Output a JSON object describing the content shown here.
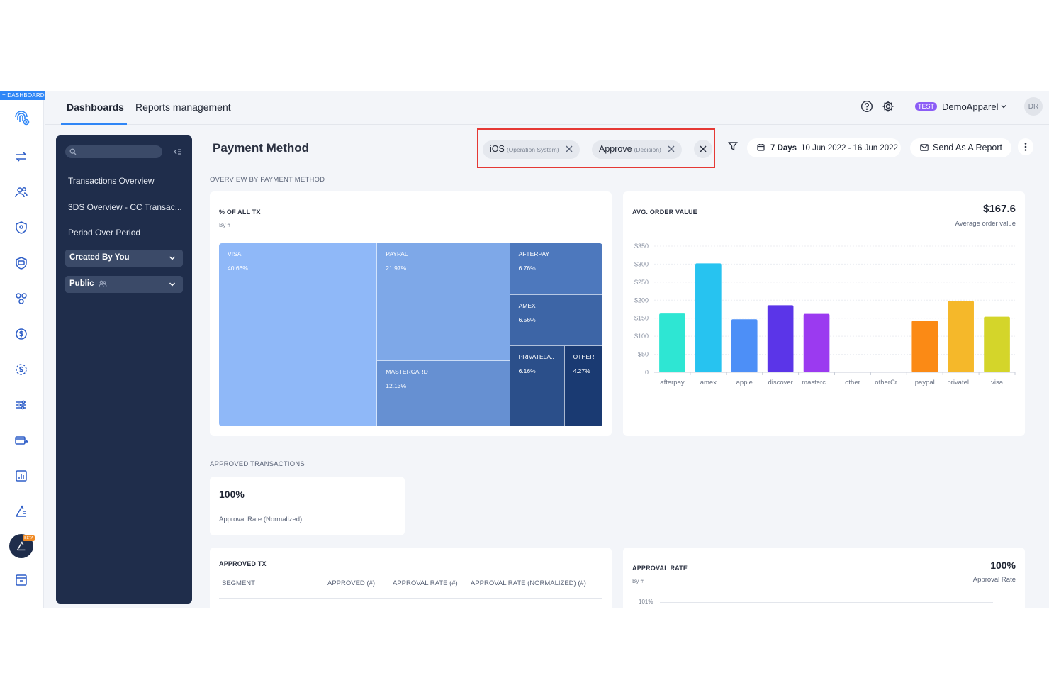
{
  "rail": {
    "tag": "= DASHBOARD",
    "beta": "BETA"
  },
  "topbar": {
    "tabs": [
      {
        "label": "Dashboards"
      },
      {
        "label": "Reports management"
      }
    ],
    "env_badge": "TEST",
    "account": "DemoApparel",
    "avatar": "DR"
  },
  "sidebar": {
    "search_placeholder": "",
    "links": [
      "Transactions Overview",
      "3DS Overview - CC Transac...",
      "Period Over Period"
    ],
    "created_by": "Created By You",
    "visibility": "Public"
  },
  "page": {
    "title": "Payment Method",
    "filters": [
      {
        "value": "iOS",
        "type": "(Operation System)"
      },
      {
        "value": "Approve",
        "type": "(Decision)"
      }
    ],
    "date": {
      "range_label": "7 Days",
      "range": "10 Jun 2022 - 16 Jun 2022"
    },
    "send_label": "Send As A Report"
  },
  "overview": {
    "section_label": "OVERVIEW BY PAYMENT METHOD",
    "treemap": {
      "title": "% OF ALL TX",
      "subtitle": "By #"
    },
    "aov": {
      "title": "AVG. ORDER VALUE",
      "value": "$167.6",
      "caption": "Average order value"
    }
  },
  "approved": {
    "section_label": "APPROVED TRANSACTIONS",
    "kpi_value": "100%",
    "kpi_caption": "Approval Rate (Normalized)",
    "tx_table": {
      "title": "APPROVED TX",
      "columns": [
        "SEGMENT",
        "APPROVED (#)",
        "APPROVAL RATE (#)",
        "APPROVAL RATE (NORMALIZED) (#)"
      ]
    },
    "approval_rate": {
      "title": "APPROVAL RATE",
      "subtitle": "By #",
      "value": "100%",
      "caption": "Approval Rate",
      "first_tick": "101%"
    }
  },
  "chart_data": [
    {
      "type": "treemap",
      "title": "% OF ALL TX",
      "subtitle": "By #",
      "items": [
        {
          "name": "VISA",
          "label": "40.66%",
          "value": 40.66,
          "color": "#8fb8f8"
        },
        {
          "name": "PAYPAL",
          "label": "21.97%",
          "value": 21.97,
          "color": "#7ea8e8"
        },
        {
          "name": "MASTERCARD",
          "label": "12.13%",
          "value": 12.13,
          "color": "#6690d2"
        },
        {
          "name": "AFTERPAY",
          "label": "6.76%",
          "value": 6.76,
          "color": "#4d78bd"
        },
        {
          "name": "AMEX",
          "label": "6.56%",
          "value": 6.56,
          "color": "#3d65a6"
        },
        {
          "name": "PRIVATELA..",
          "label": "6.16%",
          "value": 6.16,
          "color": "#2b4f8a"
        },
        {
          "name": "OTHER",
          "label": "4.27%",
          "value": 4.27,
          "color": "#1a3a72"
        }
      ]
    },
    {
      "type": "bar",
      "title": "AVG. ORDER VALUE",
      "categories": [
        "afterpay",
        "amex",
        "apple",
        "discover",
        "masterc...",
        "other",
        "otherCr...",
        "paypal",
        "privatel...",
        "visa"
      ],
      "values": [
        163,
        302,
        147,
        186,
        162,
        0,
        0,
        143,
        198,
        154
      ],
      "colors": [
        "#2ee6d3",
        "#27c3f0",
        "#4d8ff7",
        "#5b35e8",
        "#9b3af0",
        "#cccccc",
        "#cccccc",
        "#fb8a15",
        "#f5b82a",
        "#d4d52a"
      ],
      "yticks": [
        "0",
        "$50",
        "$100",
        "$150",
        "$200",
        "$250",
        "$300",
        "$350"
      ],
      "ylim": [
        0,
        350
      ],
      "grid": true
    }
  ]
}
